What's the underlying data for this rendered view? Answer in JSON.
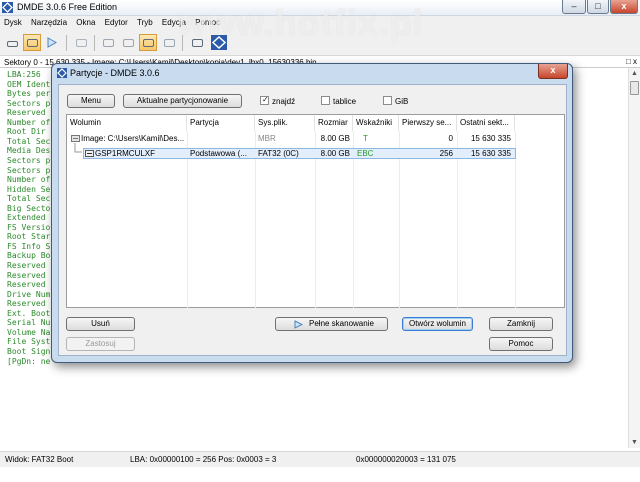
{
  "app": {
    "title": "DMDE 3.0.6 Free Edition",
    "watermark": "www.hotfix.pl",
    "window_controls": [
      "–",
      "□",
      "x"
    ]
  },
  "menu": [
    "Dysk",
    "Narzędzia",
    "Okna",
    "Edytor",
    "Tryb",
    "Edycja",
    "Pomoc"
  ],
  "sector_bar": {
    "text": "Sektory 0 - 15 630 335 - Image: C:\\Users\\Kamil\\Desktop\\kopia\\dev1_lbx0_15630336.bin",
    "controls": "□ x"
  },
  "hex_lines": [
    "LBA:256",
    "OEM Ident",
    "Bytes per",
    "Sectors p",
    "Reserved",
    "Number of",
    "Root Dir",
    "Total Sec",
    "Media Des",
    "Sectors p",
    "Sectors p",
    "Number of",
    "Hidden Se",
    "Total Sec",
    "Big Secto",
    "Extended",
    "FS Versio",
    "Root Star",
    "FS Info S",
    "Backup Bo",
    "Reserved",
    "Reserved",
    "Reserved",
    "Drive Num",
    "Reserved",
    "Ext. Boot",
    "Serial Nu",
    "Volume Na",
    "File Syst",
    "Boot Sign",
    "[PgDn: ne"
  ],
  "status": {
    "view": "Widok:  FAT32 Boot",
    "lba": "LBA: 0x00000100 = 256  Pos: 0x0003 = 3",
    "value": "0x000000020003 = 131 075"
  },
  "dialog": {
    "title": "Partycje - DMDE 3.0.6",
    "close": "x",
    "menu_button": "Menu",
    "current_partitioning_button": "Aktualne partycjonowanie",
    "checkboxes": [
      {
        "label": "znajdź",
        "checked": true
      },
      {
        "label": "tablice",
        "checked": false
      },
      {
        "label": "GiB",
        "checked": false
      }
    ],
    "columns": [
      "Wolumin",
      "Partycja",
      "Sys.plik.",
      "Rozmiar",
      "Wskaźniki",
      "Pierwszy se...",
      "Ostatni sekt..."
    ],
    "rows": [
      {
        "volume": "Image: C:\\Users\\Kamil\\Des...",
        "partition": "",
        "fs": "MBR",
        "size": "8.00 GB",
        "flags": "T",
        "first": "0",
        "last": "15 630 335"
      },
      {
        "volume": "GSP1RMCULXF",
        "partition": "Podstawowa (...",
        "fs": "FAT32 (0C)",
        "size": "8.00 GB",
        "flags": "EBC",
        "first": "256",
        "last": "15 630 335"
      }
    ],
    "buttons": {
      "delete": "Usuń",
      "apply": "Zastosuj",
      "full_scan": "Pełne skanowanie",
      "open_volume": "Otwórz wolumin",
      "close": "Zamknij",
      "help": "Pomoc"
    },
    "colors": {
      "flags_green": "#2a9a2a",
      "selection": "#e2eefb"
    }
  }
}
